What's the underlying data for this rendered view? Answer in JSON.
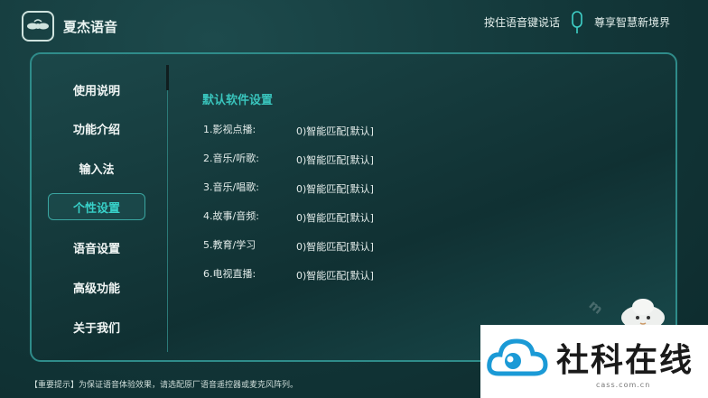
{
  "header": {
    "app_title": "夏杰语音",
    "voice_hint": "按住语音键说话",
    "slogan": "尊享智慧新境界"
  },
  "sidebar": {
    "items": [
      {
        "label": "使用说明",
        "active": false
      },
      {
        "label": "功能介绍",
        "active": false
      },
      {
        "label": "输入法",
        "active": false
      },
      {
        "label": "个性设置",
        "active": true
      },
      {
        "label": "语音设置",
        "active": false
      },
      {
        "label": "高级功能",
        "active": false
      },
      {
        "label": "关于我们",
        "active": false
      }
    ]
  },
  "content": {
    "section_title": "默认软件设置",
    "rows": [
      {
        "label": "1.影视点播:",
        "value": "0)智能匹配[默认]"
      },
      {
        "label": "2.音乐/听歌:",
        "value": "0)智能匹配[默认]"
      },
      {
        "label": "3.音乐/唱歌:",
        "value": "0)智能匹配[默认]"
      },
      {
        "label": "4.故事/音频:",
        "value": "0)智能匹配[默认]"
      },
      {
        "label": "5.教育/学习",
        "value": "0)智能匹配[默认]"
      },
      {
        "label": "6.电视直播:",
        "value": "0)智能匹配[默认]"
      }
    ]
  },
  "footer": {
    "notice": "【重要提示】为保证语音体验效果，请选配原厂语音遥控器或麦克风阵列。"
  },
  "watermark": {
    "faint_text": "m",
    "brand": "社科在线",
    "url": "cass.com.cn"
  },
  "colors": {
    "accent": "#39c4bc",
    "border": "#2f8c8a",
    "background": "#123638"
  }
}
